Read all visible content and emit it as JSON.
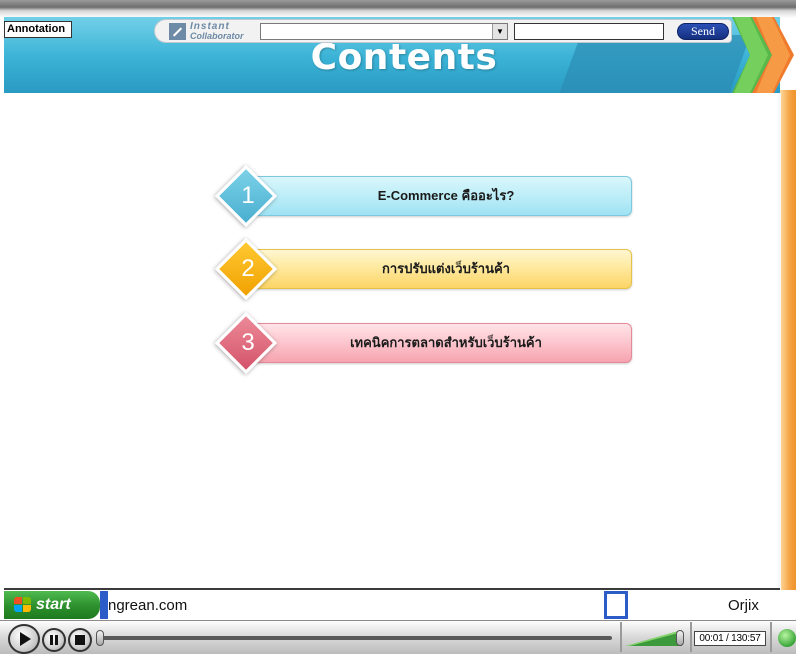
{
  "slide": {
    "title": "Contents",
    "items": [
      {
        "number": "1",
        "label": "E-Commerce คืออะไร?"
      },
      {
        "number": "2",
        "label": "การปรับแต่งเว็บร้านค้า"
      },
      {
        "number": "3",
        "label": "เทคนิคการตลาดสำหรับเว็บร้านค้า"
      }
    ]
  },
  "toolbar": {
    "annotation_label": "Annotation",
    "logo_line1": "Instant",
    "logo_line2": "Collaborator",
    "channel_select_value": "",
    "message_input_value": "",
    "send_label": "Send"
  },
  "taskbar": {
    "start_label": "start",
    "url_text": "ngrean.com",
    "tray_text": "Orjix"
  },
  "player": {
    "timecode": "00:01 / 130:57",
    "progress_fraction": 0.0
  },
  "colors": {
    "banner": "#3ab2d6",
    "item1": "#bdeef8",
    "item2": "#fee89a",
    "item3": "#fcc5cd",
    "send_button": "#1e3e9c",
    "start_button": "#2c8f2c"
  }
}
